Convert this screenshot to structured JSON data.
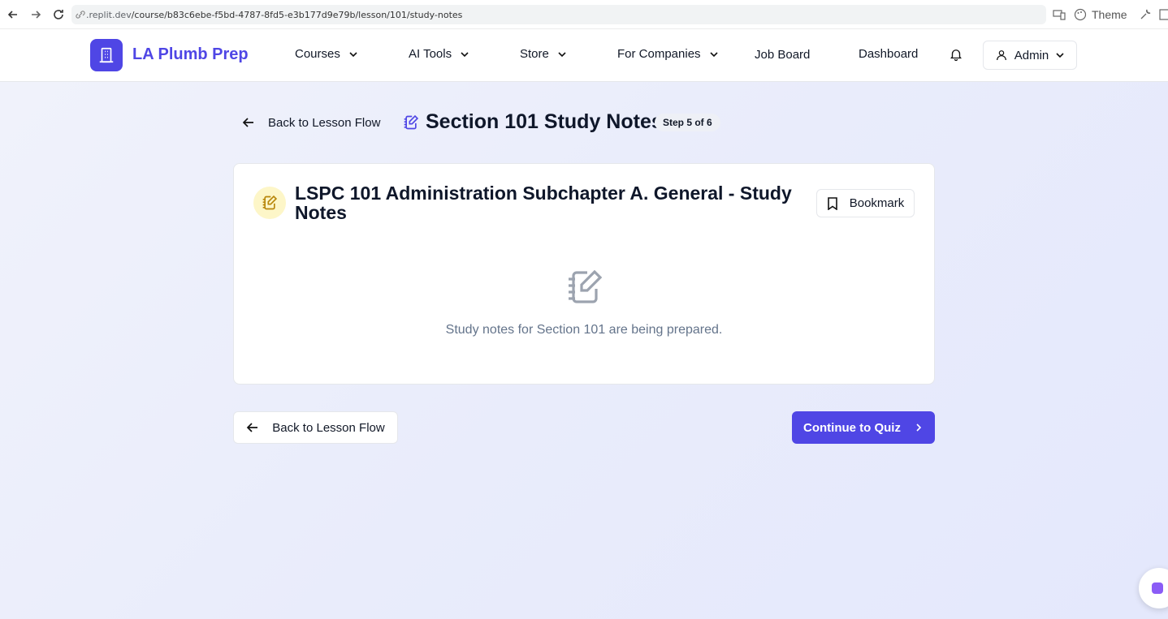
{
  "browser": {
    "url_domain": ".replit.dev",
    "url_path": "/course/b83c6ebe-f5bd-4787-8fd5-e3b177d9e79b/lesson/101/study-notes",
    "theme_label": "Theme"
  },
  "header": {
    "brand": "LA Plumb Prep",
    "nav": {
      "courses": "Courses",
      "ai_tools": "AI Tools",
      "store": "Store",
      "for_companies": "For Companies",
      "job_board": "Job Board",
      "dashboard": "Dashboard"
    },
    "user_label": "Admin"
  },
  "page": {
    "back_label": "Back to Lesson Flow",
    "title": "Section 101 Study Notes",
    "step_badge": "Step 5 of 6"
  },
  "card": {
    "title": "LSPC 101 Administration Subchapter A. General - Study Notes",
    "bookmark_label": "Bookmark",
    "empty_message": "Study notes for Section 101 are being prepared."
  },
  "footer_actions": {
    "back_label": "Back to Lesson Flow",
    "continue_label": "Continue to Quiz"
  },
  "colors": {
    "brand": "#4f46e5",
    "icon_bg": "#fdf6c8",
    "muted_text": "#64748b"
  }
}
